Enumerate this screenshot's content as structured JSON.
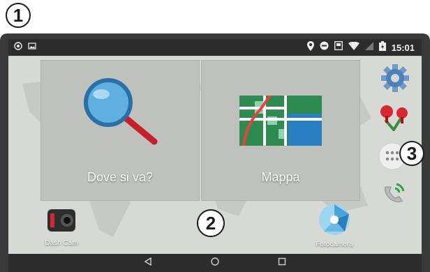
{
  "status_bar": {
    "time": "15:01",
    "icons": [
      "gps-icon",
      "dnd-icon",
      "display-icon",
      "wifi-icon",
      "no-sim-icon",
      "battery-icon"
    ]
  },
  "tiles": [
    {
      "label": "Dove si va?",
      "icon": "magnifier-icon"
    },
    {
      "label": "Mappa",
      "icon": "map-icon"
    }
  ],
  "sidebar": {
    "icons": [
      "settings-icon",
      "pins-icon",
      "apps-drawer-icon",
      "phone-icon"
    ]
  },
  "apps": [
    {
      "label": "Dash Cam",
      "icon": "dashcam-icon"
    },
    {
      "label": "Fotocamera",
      "icon": "camera-icon"
    }
  ],
  "nav_bar": {
    "icons": [
      "back-icon",
      "home-icon",
      "recents-icon"
    ]
  },
  "callouts": {
    "c1": "1",
    "c2": "2",
    "c3": "3"
  },
  "colors": {
    "accent_blue": "#3a86c8",
    "map_green": "#2e8b4f",
    "status_bar": "#2c2c2c"
  }
}
